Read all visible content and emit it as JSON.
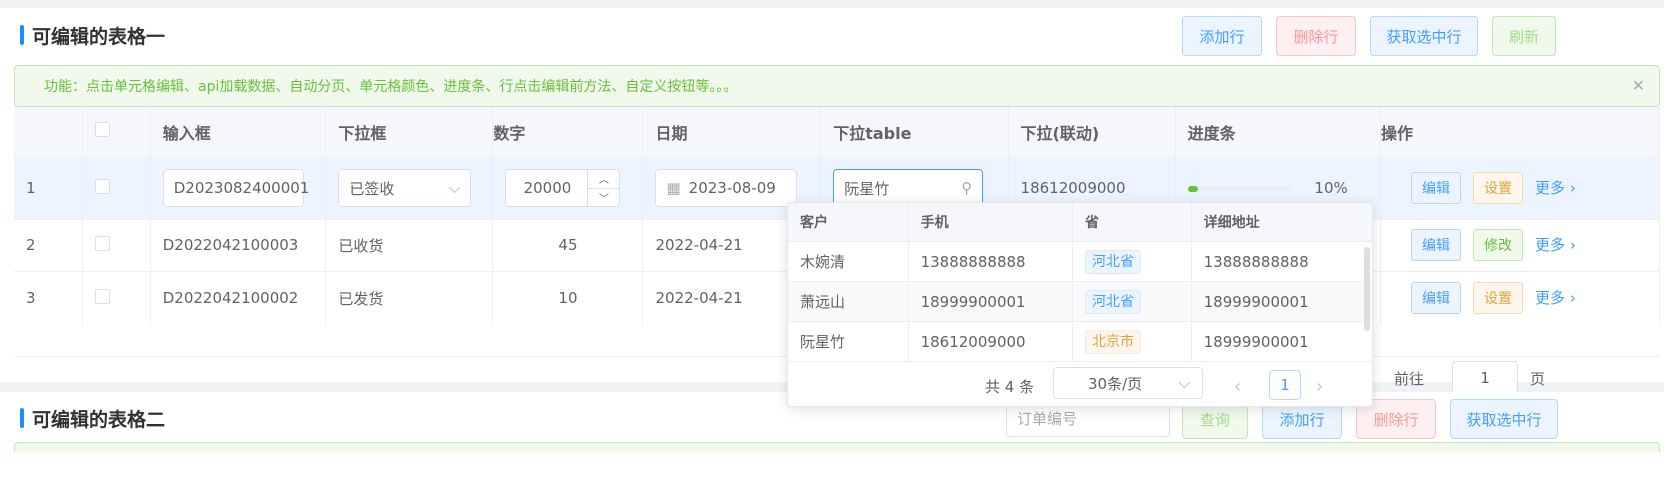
{
  "table1": {
    "title": "可编辑的表格一",
    "buttons": {
      "add_row": "添加行",
      "delete_row": "删除行",
      "get_selected": "获取选中行",
      "refresh": "刷新"
    },
    "alert": "功能：点击单元格编辑、api加载数据、自动分页、单元格颜色、进度条、行点击编辑前方法、自定义按钮等。。。",
    "columns": [
      "",
      "",
      "输入框",
      "下拉框",
      "数字",
      "日期",
      "下拉table",
      "下拉(联动)",
      "进度条",
      "操作"
    ],
    "rows": [
      {
        "idx": "1",
        "input": "D2023082400001",
        "select": "已签收",
        "number": "20000",
        "date": "2023-08-09",
        "table_select": "阮星竹",
        "linked": "18612009000",
        "progress_label": "10%",
        "progress": 0.1,
        "actions": [
          "编辑",
          "设置"
        ],
        "more": "更多"
      },
      {
        "idx": "2",
        "input": "D2022042100003",
        "select": "已收货",
        "number": "45",
        "date": "2022-04-21",
        "actions": [
          "编辑",
          "修改"
        ],
        "more": "更多"
      },
      {
        "idx": "3",
        "input": "D2022042100002",
        "select": "已发货",
        "number": "10",
        "date": "2022-04-21",
        "actions": [
          "编辑",
          "设置"
        ],
        "more": "更多"
      }
    ],
    "pager": {
      "goto_label": "前往",
      "page_value": "1",
      "page_unit": "页"
    }
  },
  "dropdown": {
    "columns": [
      "客户",
      "手机",
      "省",
      "详细地址"
    ],
    "rows": [
      {
        "name": "木婉清",
        "phone": "13888888888",
        "province": "河北省",
        "address": "13888888888",
        "tag_color": "blue"
      },
      {
        "name": "萧远山",
        "phone": "18999900001",
        "province": "河北省",
        "address": "18999900001",
        "tag_color": "blue"
      },
      {
        "name": "阮星竹",
        "phone": "18612009000",
        "province": "北京市",
        "address": "18999900001",
        "tag_color": "orange"
      }
    ],
    "total": "共 4 条",
    "page_size": "30条/页",
    "current_page": "1"
  },
  "table2": {
    "title": "可编辑的表格二",
    "search_placeholder": "订单编号",
    "buttons": {
      "query": "查询",
      "add_row": "添加行",
      "delete_row": "删除行",
      "get_selected": "获取选中行"
    }
  },
  "colors": {
    "primary": "#409eff",
    "success": "#67c23a",
    "warning": "#e6a23c",
    "danger": "#f89898"
  }
}
